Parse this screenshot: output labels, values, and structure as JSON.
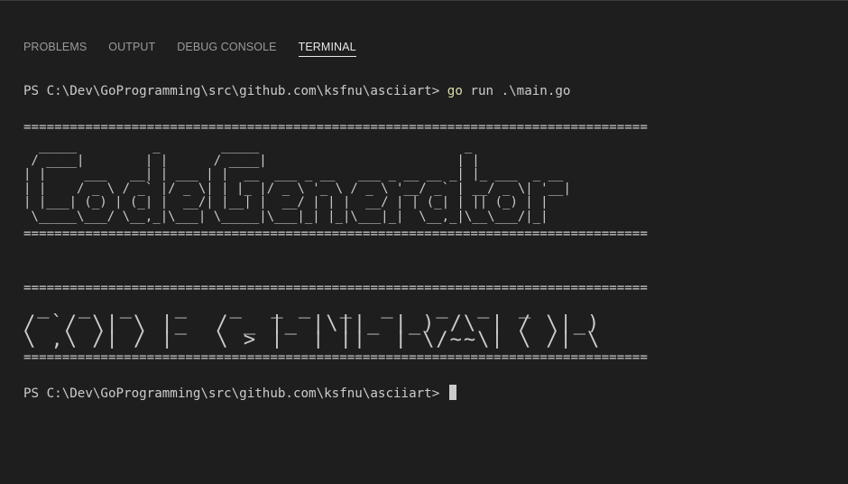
{
  "panel": {
    "tabs": [
      {
        "label": "PROBLEMS",
        "active": false
      },
      {
        "label": "OUTPUT",
        "active": false
      },
      {
        "label": "DEBUG CONSOLE",
        "active": false
      },
      {
        "label": "TERMINAL",
        "active": true
      }
    ]
  },
  "terminal": {
    "prompt": "PS C:\\Dev\\GoProgramming\\src\\github.com\\ksfnu\\asciiart> ",
    "command_keyword": "go",
    "command_args": " run .\\main.go",
    "separator": "=================================================================================",
    "big_banner_art": "  _____          _        _____                           _             \n / ____|        | |      / ____|                         | |            \n| |     ___   __| | ___ | |  __  ___ _ __   ___ _ __ __ _| |_ ___  _ __ \n| |    / _ \\ / _` |/ _ \\| | |_ |/ _ \\ '_ \\ / _ \\ '__/ _` | __/ _ \\| '__|\n| |___| (_) | (_| |  __/| |__| |  __/ | | |  __/ | | (_| | || (_) | |   \n \\_____\\___/ \\__,_|\\___| \\_____|\\___|_| |_|\\___|_|  \\__,_|\\__\\___/|_|   ",
    "small_banner_art": " _  _  _   _   _  _ _  _  _   _  _  _   \n/ `/ \\| \\ |_  / _ |_ |\\||_ |_) /\\ | / \\|_) \n\\_,\\_/|_/ |_  \\_> |_ | ||_ | \\/~~\\| \\_/| \\ ",
    "final_prompt": "PS C:\\Dev\\GoProgramming\\src\\github.com\\ksfnu\\asciiart> "
  },
  "colors": {
    "background": "#1e1e1e",
    "text": "#cccccc",
    "command": "#dcdcaa",
    "tab_inactive": "#9a9a9a",
    "tab_active": "#e7e7e7"
  }
}
